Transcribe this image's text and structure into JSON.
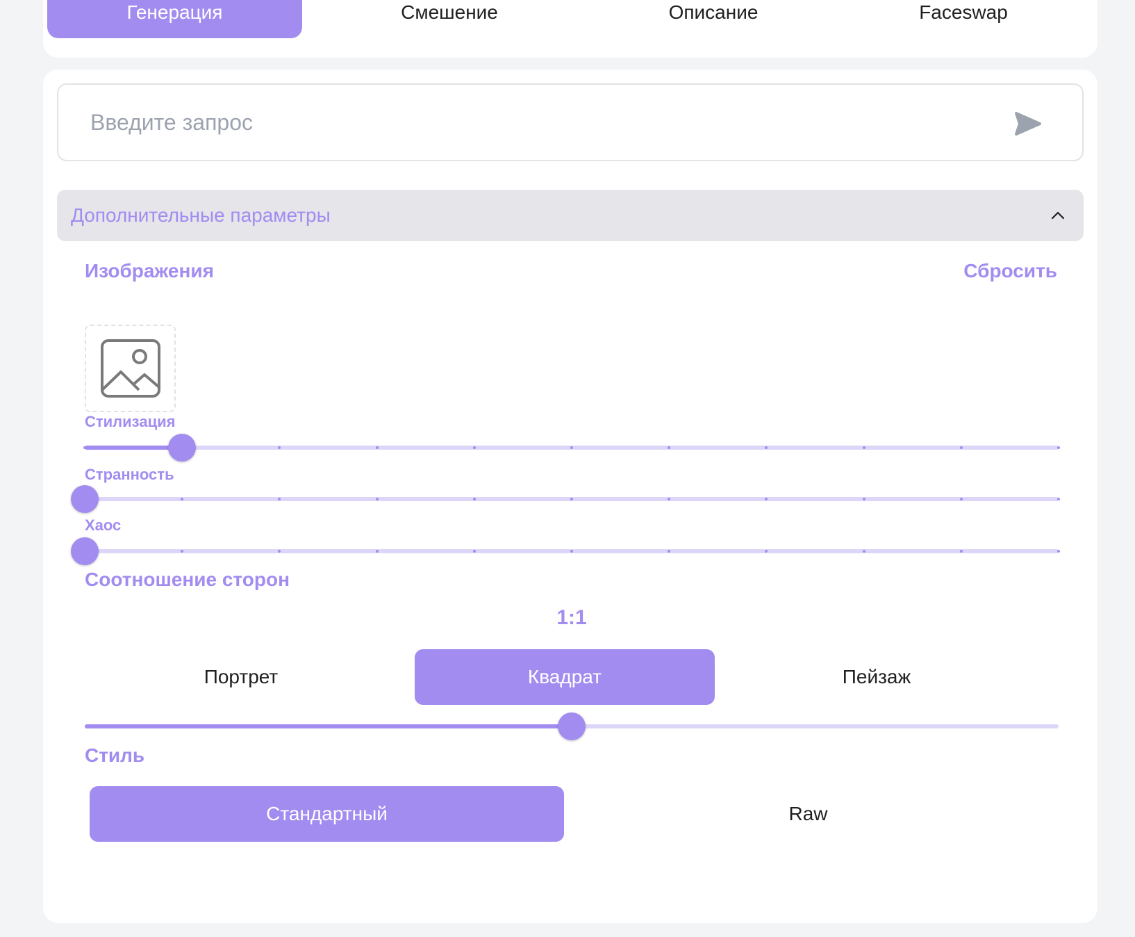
{
  "tabs": [
    {
      "label": "Генерация",
      "active": true
    },
    {
      "label": "Смешение",
      "active": false
    },
    {
      "label": "Описание",
      "active": false
    },
    {
      "label": "Faceswap",
      "active": false
    }
  ],
  "search": {
    "placeholder": "Введите запрос",
    "value": ""
  },
  "advanced": {
    "title": "Дополнительные параметры",
    "expanded": true
  },
  "images": {
    "label": "Изображения",
    "reset_label": "Сбросить"
  },
  "sliders": [
    {
      "label": "Стилизация",
      "value_fraction": 0.1,
      "ticks": 11
    },
    {
      "label": "Странность",
      "value_fraction": 0.0,
      "ticks": 11
    },
    {
      "label": "Хаос",
      "value_fraction": 0.0,
      "ticks": 11
    }
  ],
  "aspect": {
    "label": "Соотношение сторон",
    "value": "1:1",
    "options": [
      "Портрет",
      "Квадрат",
      "Пейзаж"
    ],
    "selected": "Квадрат",
    "slider_fraction": 0.5
  },
  "style": {
    "label": "Стиль",
    "options": [
      "Стандартный",
      "Raw"
    ],
    "selected": "Стандартный"
  },
  "colors": {
    "accent": "#a28cf0",
    "accent_light": "#ddd6f8",
    "background": "#f3f4f6"
  },
  "icons": {
    "send": "send-icon",
    "chevron": "chevron-up-icon",
    "image": "image-icon"
  }
}
